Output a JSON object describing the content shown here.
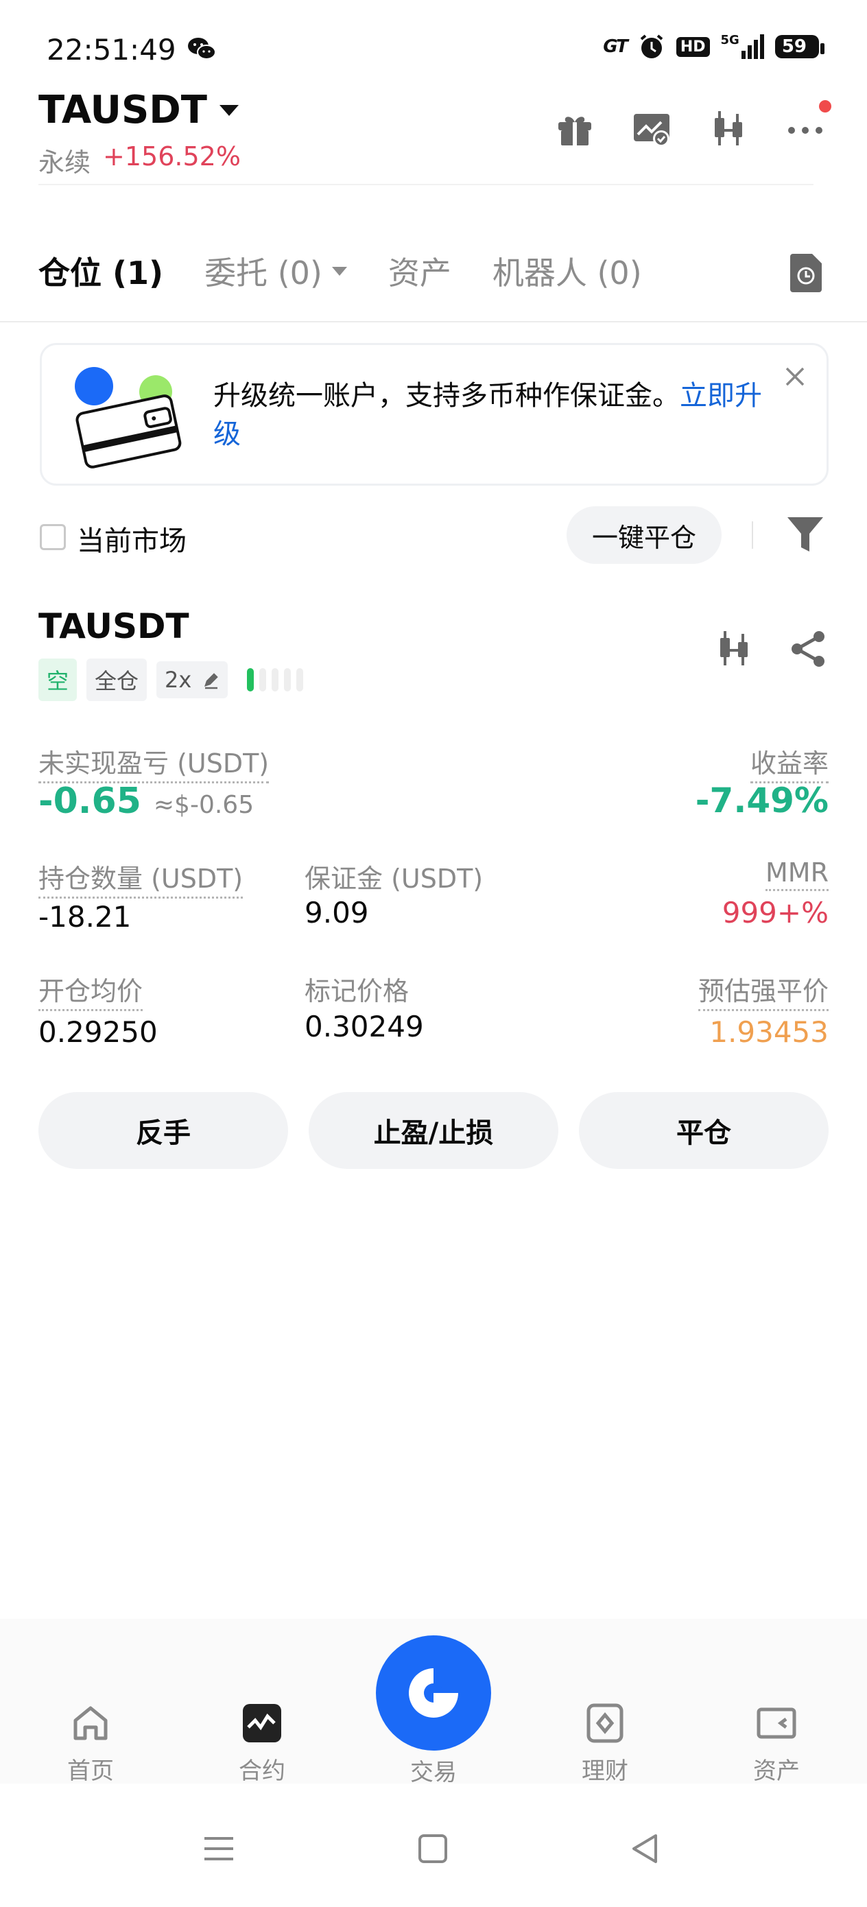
{
  "status_bar": {
    "time": "22:51:49",
    "gt": "GT",
    "hd": "HD",
    "network": "5G",
    "battery": "59",
    "icons": [
      "wechat-icon",
      "alarm-icon",
      "signal-icon",
      "battery-icon"
    ]
  },
  "header": {
    "pair": "TAUSDT",
    "type": "永续",
    "change": "+156.52%",
    "icons": [
      "gift-icon",
      "chart-settings-icon",
      "candlestick-icon",
      "more-icon"
    ]
  },
  "tabs": [
    {
      "label": "仓位 (1)",
      "active": true
    },
    {
      "label": "委托 (0)",
      "active": false
    },
    {
      "label": "资产",
      "active": false
    },
    {
      "label": "机器人 (0)",
      "active": false
    }
  ],
  "banner": {
    "text": "升级统一账户，支持多币种作保证金。",
    "link": "立即升级"
  },
  "filters": {
    "current_market": "当前市场",
    "close_all": "一键平仓"
  },
  "position": {
    "symbol": "TAUSDT",
    "side": "空",
    "margin_mode": "全仓",
    "leverage": "2x",
    "risk_level_segments": 5,
    "risk_level_active": 1,
    "unrealized_pnl_label": "未实现盈亏 (USDT)",
    "unrealized_pnl": "-0.65",
    "unrealized_pnl_usd": "≈$-0.65",
    "roe_label": "收益率",
    "roe": "-7.49%",
    "qty_label": "持仓数量 (USDT)",
    "qty": "-18.21",
    "margin_label": "保证金 (USDT)",
    "margin": "9.09",
    "mmr_label": "MMR",
    "mmr": "999+%",
    "entry_label": "开仓均价",
    "entry": "0.29250",
    "mark_label": "标记价格",
    "mark": "0.30249",
    "liq_label": "预估强平价",
    "liq": "1.93453",
    "actions": [
      "反手",
      "止盈/止损",
      "平仓"
    ]
  },
  "bottom_nav": {
    "items": [
      "首页",
      "合约",
      "交易",
      "理财",
      "资产"
    ],
    "active": "合约"
  },
  "colors": {
    "green": "#20b287",
    "red": "#e0435a",
    "orange": "#f0a050",
    "blue": "#1b6af7"
  }
}
